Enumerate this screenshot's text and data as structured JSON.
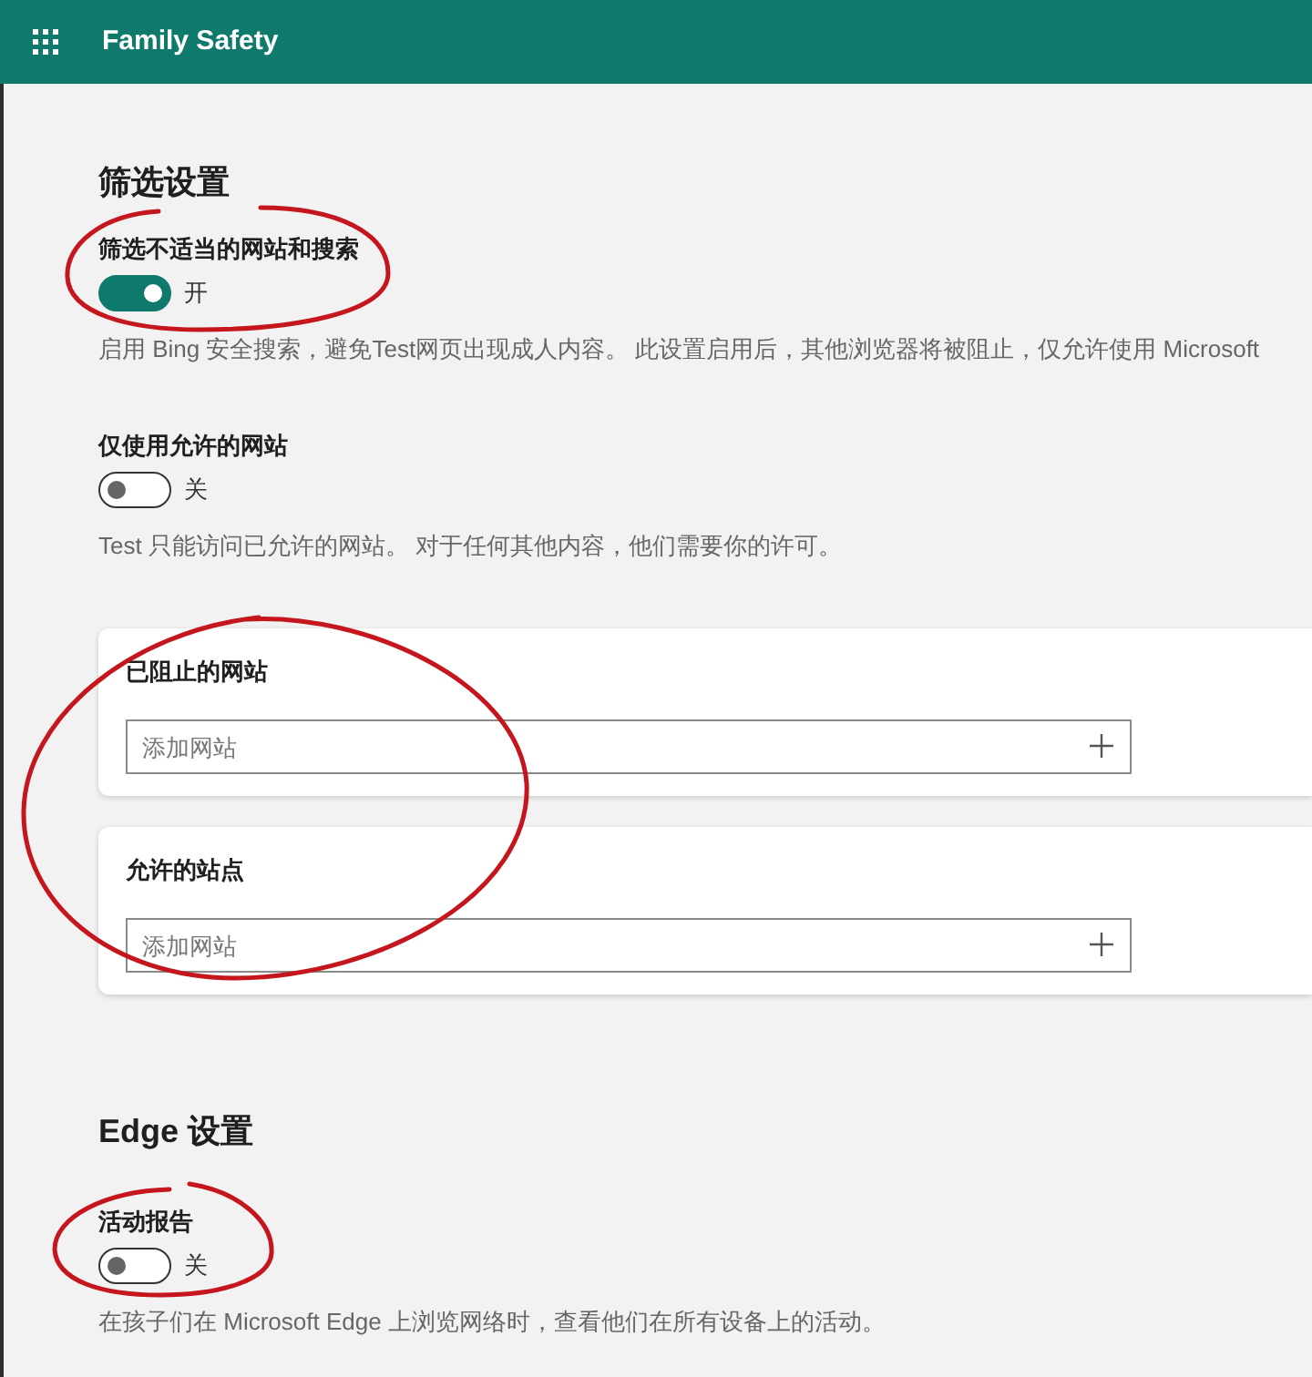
{
  "header": {
    "title": "Family Safety"
  },
  "sections": [
    {
      "title": "筛选设置",
      "settings": [
        {
          "label": "筛选不适当的网站和搜索",
          "on": true,
          "state_text": "开",
          "description": "启用 Bing 安全搜索，避免Test网页出现成人内容。 此设置启用后，其他浏览器将被阻止，仅允许使用 Microsoft"
        },
        {
          "label": "仅使用允许的网站",
          "on": false,
          "state_text": "关",
          "description": "Test 只能访问已允许的网站。 对于任何其他内容，他们需要你的许可。"
        }
      ],
      "cards": [
        {
          "title": "已阻止的网站",
          "placeholder": "添加网站"
        },
        {
          "title": "允许的站点",
          "placeholder": "添加网站"
        }
      ]
    },
    {
      "title": "Edge 设置",
      "settings": [
        {
          "label": "活动报告",
          "on": false,
          "state_text": "关",
          "description": "在孩子们在 Microsoft Edge 上浏览网络时，查看他们在所有设备上的活动。"
        }
      ]
    }
  ]
}
